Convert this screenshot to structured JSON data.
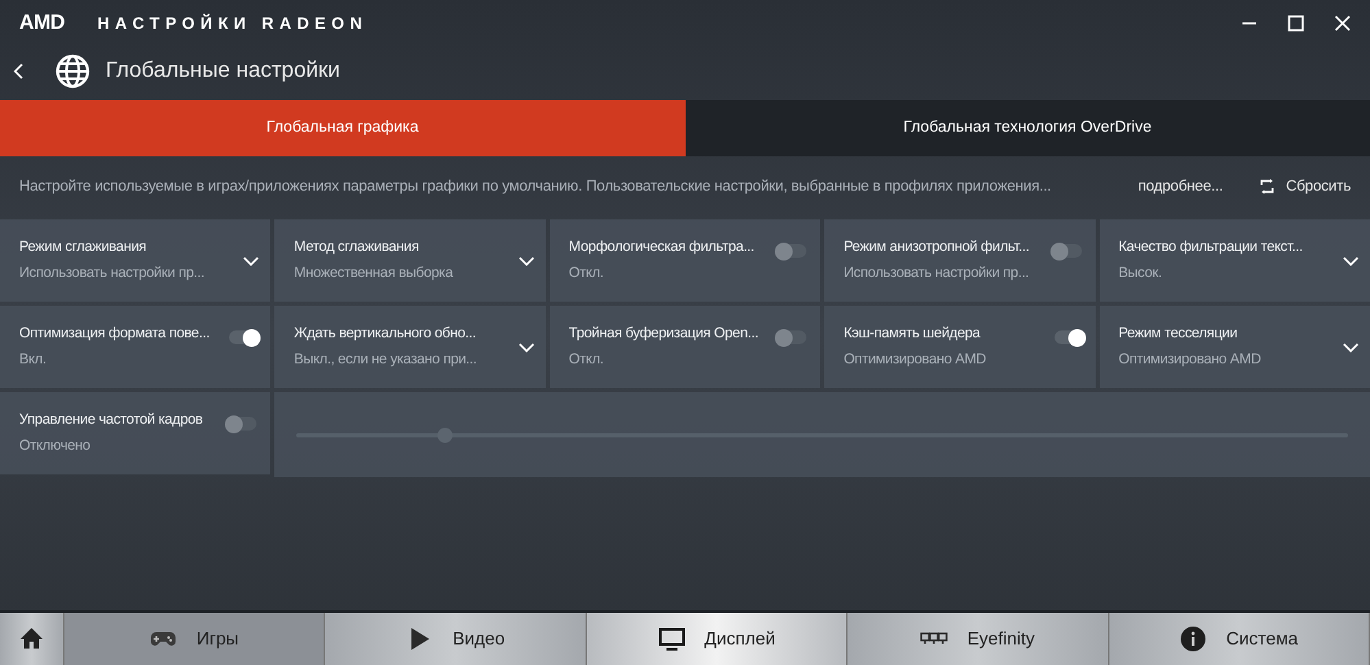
{
  "app": {
    "logo": "AMD",
    "title": "НАСТРОЙКИ RADEON"
  },
  "header": {
    "title": "Глобальные настройки"
  },
  "tabs": [
    {
      "label": "Глобальная графика",
      "selected": true
    },
    {
      "label": "Глобальная технология OverDrive",
      "selected": false
    }
  ],
  "description": "Настройте используемые в играх/приложениях параметры графики по умолчанию.  Пользовательские настройки, выбранные в профилях приложения...",
  "more_link": "подробнее...",
  "reset_button": "Сбросить",
  "settings": [
    {
      "kind": "dropdown",
      "label": "Режим сглаживания",
      "value": "Использовать настройки пр..."
    },
    {
      "kind": "dropdown",
      "label": "Метод сглаживания",
      "value": "Множественная выборка"
    },
    {
      "kind": "toggle",
      "label": "Морфологическая фильтра...",
      "value": "Откл.",
      "on": false
    },
    {
      "kind": "toggle",
      "label": "Режим анизотропной фильт...",
      "value": "Использовать настройки пр...",
      "on": false
    },
    {
      "kind": "dropdown",
      "label": "Качество фильтрации текст...",
      "value": "Высок."
    },
    {
      "kind": "toggle",
      "label": "Оптимизация формата пове...",
      "value": "Вкл.",
      "on": true
    },
    {
      "kind": "dropdown",
      "label": "Ждать вертикального обно...",
      "value": "Выкл., если не указано при..."
    },
    {
      "kind": "toggle",
      "label": "Тройная буферизация Open...",
      "value": "Откл.",
      "on": false
    },
    {
      "kind": "toggle",
      "label": "Кэш-память шейдера",
      "value": "Оптимизировано AMD",
      "on": true
    },
    {
      "kind": "dropdown",
      "label": "Режим тесселяции",
      "value": "Оптимизировано AMD"
    },
    {
      "kind": "toggle",
      "label": "Управление частотой кадров",
      "value": "Отключено",
      "on": false
    },
    {
      "kind": "slider",
      "disabled": true,
      "level": 0.14
    }
  ],
  "nav": [
    {
      "kind": "home",
      "selected": false
    },
    {
      "kind": "gamepad",
      "label": "Игры",
      "selected": true
    },
    {
      "kind": "play",
      "label": "Видео",
      "selected": false
    },
    {
      "kind": "monitor",
      "label": "Дисплей",
      "selected": false
    },
    {
      "kind": "eyefinity",
      "label": "Eyefinity",
      "selected": false
    },
    {
      "kind": "info",
      "label": "Система",
      "selected": false
    }
  ]
}
